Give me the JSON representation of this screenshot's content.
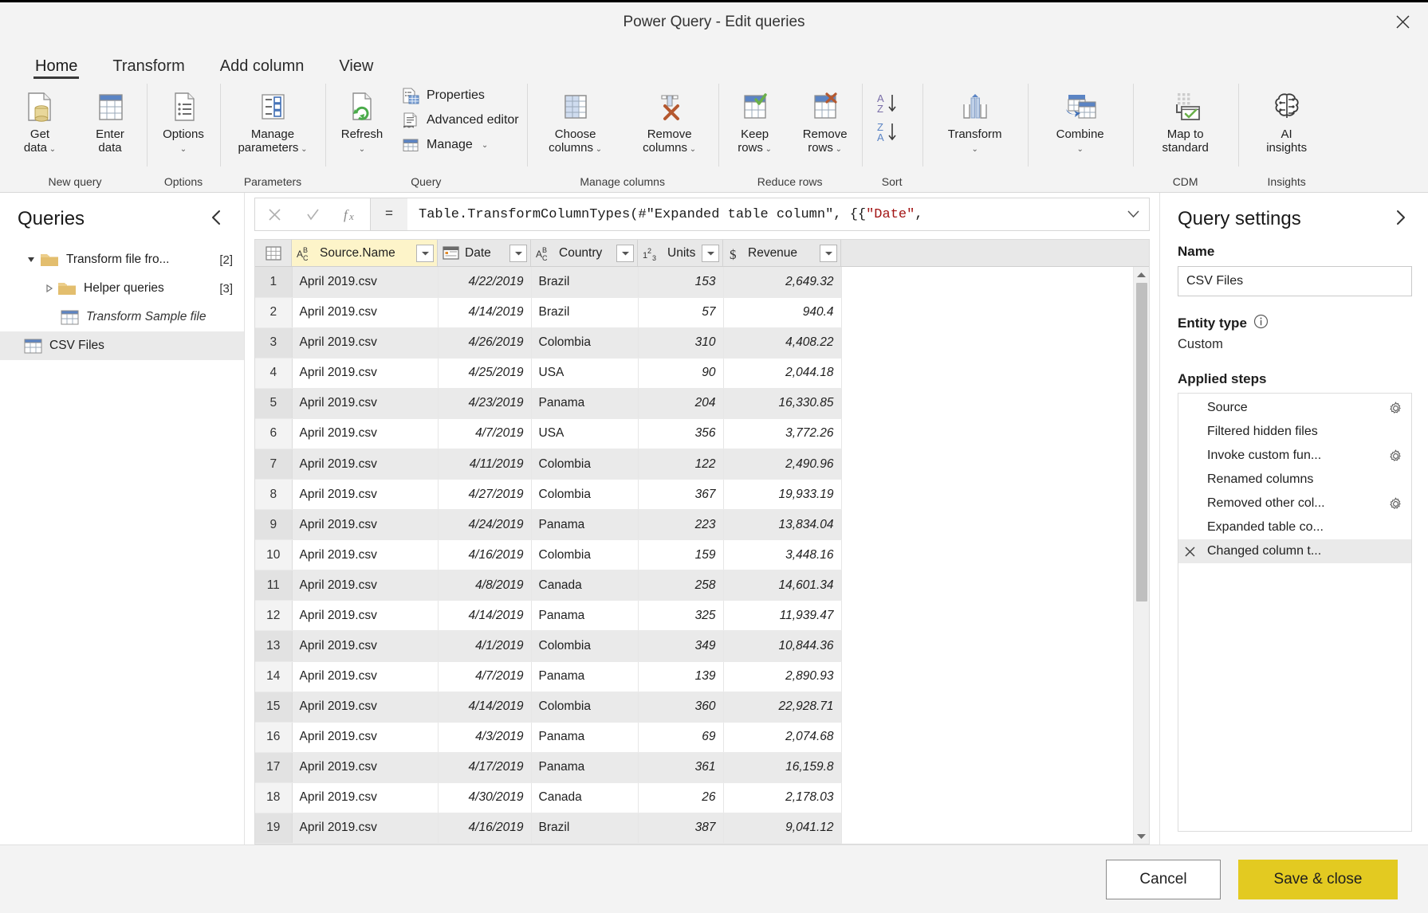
{
  "window": {
    "title": "Power Query - Edit queries",
    "close_icon": "close-icon"
  },
  "tabs": [
    {
      "label": "Home",
      "active": true
    },
    {
      "label": "Transform",
      "active": false
    },
    {
      "label": "Add column",
      "active": false
    },
    {
      "label": "View",
      "active": false
    }
  ],
  "ribbon": {
    "groups": [
      {
        "label": "New query",
        "buttons": [
          {
            "line1": "Get",
            "line2": "data",
            "chevron": true,
            "icon": "get-data-icon"
          },
          {
            "line1": "Enter",
            "line2": "data",
            "chevron": false,
            "icon": "enter-data-icon"
          }
        ]
      },
      {
        "label": "Options",
        "buttons": [
          {
            "line1": "Options",
            "line2": "",
            "chevron": true,
            "icon": "options-icon"
          }
        ]
      },
      {
        "label": "Parameters",
        "buttons": [
          {
            "line1": "Manage",
            "line2": "parameters",
            "chevron": true,
            "icon": "manage-parameters-icon"
          }
        ]
      },
      {
        "label": "Query",
        "buttons": [
          {
            "line1": "Refresh",
            "line2": "",
            "chevron": true,
            "icon": "refresh-icon"
          }
        ],
        "small_buttons": [
          {
            "label": "Properties",
            "icon": "properties-icon",
            "chevron": false
          },
          {
            "label": "Advanced editor",
            "icon": "advanced-editor-icon",
            "chevron": false
          },
          {
            "label": "Manage",
            "icon": "manage-icon",
            "chevron": true
          }
        ]
      },
      {
        "label": "Manage columns",
        "buttons": [
          {
            "line1": "Choose",
            "line2": "columns",
            "chevron": true,
            "icon": "choose-columns-icon"
          },
          {
            "line1": "Remove",
            "line2": "columns",
            "chevron": true,
            "icon": "remove-columns-icon"
          }
        ]
      },
      {
        "label": "Reduce rows",
        "buttons": [
          {
            "line1": "Keep",
            "line2": "rows",
            "chevron": true,
            "icon": "keep-rows-icon"
          },
          {
            "line1": "Remove",
            "line2": "rows",
            "chevron": true,
            "icon": "remove-rows-icon"
          }
        ]
      },
      {
        "label": "Sort",
        "sort": [
          {
            "icon": "sort-ascending-icon"
          },
          {
            "icon": "sort-descending-icon"
          }
        ]
      },
      {
        "label": "",
        "buttons": [
          {
            "line1": "Transform",
            "line2": "",
            "chevron": true,
            "icon": "transform-icon"
          }
        ]
      },
      {
        "label": "",
        "buttons": [
          {
            "line1": "Combine",
            "line2": "",
            "chevron": true,
            "icon": "combine-icon"
          }
        ]
      },
      {
        "label": "CDM",
        "buttons": [
          {
            "line1": "Map to",
            "line2": "standard",
            "chevron": false,
            "icon": "map-to-standard-icon"
          }
        ]
      },
      {
        "label": "Insights",
        "buttons": [
          {
            "line1": "AI",
            "line2": "insights",
            "chevron": false,
            "icon": "ai-insights-icon"
          }
        ]
      }
    ]
  },
  "queries_pane": {
    "title": "Queries",
    "collapse_icon": "chevron-left-icon",
    "items": [
      {
        "name": "Transform file fro...",
        "count": "[2]",
        "type": "folder",
        "indent": 0,
        "arrow": "expanded",
        "selected": false,
        "italic": false
      },
      {
        "name": "Helper queries",
        "count": "[3]",
        "type": "folder",
        "indent": 1,
        "arrow": "collapsed",
        "selected": false,
        "italic": false
      },
      {
        "name": "Transform Sample file",
        "count": "",
        "type": "table",
        "indent": 2,
        "arrow": "none",
        "selected": false,
        "italic": true
      },
      {
        "name": "CSV Files",
        "count": "",
        "type": "table",
        "indent": 0,
        "arrow": "none",
        "selected": true,
        "italic": false
      }
    ]
  },
  "formula_bar": {
    "cancel_icon": "cancel-formula-icon",
    "accept_icon": "accept-formula-icon",
    "fx_icon": "fx-icon",
    "equals": "=",
    "text_before": "Table.TransformColumnTypes(#\"Expanded table column\", {{",
    "text_string": "\"Date\"",
    "text_after": ",",
    "expand_icon": "chevron-down-icon"
  },
  "grid": {
    "corner_icon": "select-all-icon",
    "columns": [
      {
        "name": "Source.Name",
        "type_icon": "abc-icon",
        "selected": true
      },
      {
        "name": "Date",
        "type_icon": "date-icon",
        "selected": false
      },
      {
        "name": "Country",
        "type_icon": "abc-icon",
        "selected": false
      },
      {
        "name": "Units",
        "type_icon": "number-icon",
        "selected": false
      },
      {
        "name": "Revenue",
        "type_icon": "currency-icon",
        "selected": false
      }
    ],
    "rows": [
      {
        "n": "1",
        "source": "April 2019.csv",
        "date": "4/22/2019",
        "country": "Brazil",
        "units": "153",
        "revenue": "2,649.32"
      },
      {
        "n": "2",
        "source": "April 2019.csv",
        "date": "4/14/2019",
        "country": "Brazil",
        "units": "57",
        "revenue": "940.4"
      },
      {
        "n": "3",
        "source": "April 2019.csv",
        "date": "4/26/2019",
        "country": "Colombia",
        "units": "310",
        "revenue": "4,408.22"
      },
      {
        "n": "4",
        "source": "April 2019.csv",
        "date": "4/25/2019",
        "country": "USA",
        "units": "90",
        "revenue": "2,044.18"
      },
      {
        "n": "5",
        "source": "April 2019.csv",
        "date": "4/23/2019",
        "country": "Panama",
        "units": "204",
        "revenue": "16,330.85"
      },
      {
        "n": "6",
        "source": "April 2019.csv",
        "date": "4/7/2019",
        "country": "USA",
        "units": "356",
        "revenue": "3,772.26"
      },
      {
        "n": "7",
        "source": "April 2019.csv",
        "date": "4/11/2019",
        "country": "Colombia",
        "units": "122",
        "revenue": "2,490.96"
      },
      {
        "n": "8",
        "source": "April 2019.csv",
        "date": "4/27/2019",
        "country": "Colombia",
        "units": "367",
        "revenue": "19,933.19"
      },
      {
        "n": "9",
        "source": "April 2019.csv",
        "date": "4/24/2019",
        "country": "Panama",
        "units": "223",
        "revenue": "13,834.04"
      },
      {
        "n": "10",
        "source": "April 2019.csv",
        "date": "4/16/2019",
        "country": "Colombia",
        "units": "159",
        "revenue": "3,448.16"
      },
      {
        "n": "11",
        "source": "April 2019.csv",
        "date": "4/8/2019",
        "country": "Canada",
        "units": "258",
        "revenue": "14,601.34"
      },
      {
        "n": "12",
        "source": "April 2019.csv",
        "date": "4/14/2019",
        "country": "Panama",
        "units": "325",
        "revenue": "11,939.47"
      },
      {
        "n": "13",
        "source": "April 2019.csv",
        "date": "4/1/2019",
        "country": "Colombia",
        "units": "349",
        "revenue": "10,844.36"
      },
      {
        "n": "14",
        "source": "April 2019.csv",
        "date": "4/7/2019",
        "country": "Panama",
        "units": "139",
        "revenue": "2,890.93"
      },
      {
        "n": "15",
        "source": "April 2019.csv",
        "date": "4/14/2019",
        "country": "Colombia",
        "units": "360",
        "revenue": "22,928.71"
      },
      {
        "n": "16",
        "source": "April 2019.csv",
        "date": "4/3/2019",
        "country": "Panama",
        "units": "69",
        "revenue": "2,074.68"
      },
      {
        "n": "17",
        "source": "April 2019.csv",
        "date": "4/17/2019",
        "country": "Panama",
        "units": "361",
        "revenue": "16,159.8"
      },
      {
        "n": "18",
        "source": "April 2019.csv",
        "date": "4/30/2019",
        "country": "Canada",
        "units": "26",
        "revenue": "2,178.03"
      },
      {
        "n": "19",
        "source": "April 2019.csv",
        "date": "4/16/2019",
        "country": "Brazil",
        "units": "387",
        "revenue": "9,041.12"
      }
    ]
  },
  "query_settings": {
    "title": "Query settings",
    "expand_icon": "chevron-right-icon",
    "name_label": "Name",
    "name_value": "CSV Files",
    "entity_type_label": "Entity type",
    "entity_type_info_icon": "info-icon",
    "entity_type_value": "Custom",
    "applied_steps_label": "Applied steps",
    "steps": [
      {
        "name": "Source",
        "gear": true,
        "selected": false,
        "delete": false
      },
      {
        "name": "Filtered hidden files",
        "gear": false,
        "selected": false,
        "delete": false
      },
      {
        "name": "Invoke custom fun...",
        "gear": true,
        "selected": false,
        "delete": false
      },
      {
        "name": "Renamed columns",
        "gear": false,
        "selected": false,
        "delete": false
      },
      {
        "name": "Removed other col...",
        "gear": true,
        "selected": false,
        "delete": false
      },
      {
        "name": "Expanded table co...",
        "gear": false,
        "selected": false,
        "delete": false
      },
      {
        "name": "Changed column t...",
        "gear": false,
        "selected": true,
        "delete": true
      }
    ]
  },
  "footer": {
    "cancel_label": "Cancel",
    "save_label": "Save & close",
    "save_color": "#e3ca21"
  }
}
